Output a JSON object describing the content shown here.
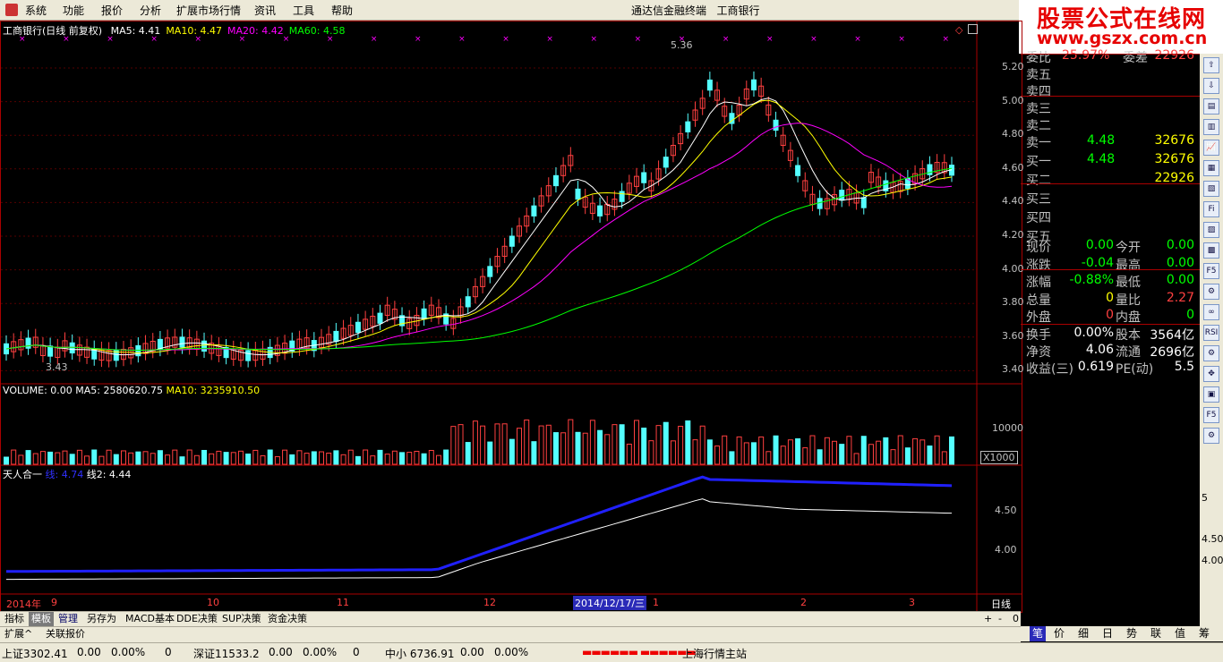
{
  "menu": {
    "items": [
      "系统",
      "功能",
      "报价",
      "分析",
      "扩展市场行情",
      "资讯",
      "工具",
      "帮助"
    ],
    "app_title": "通达信金融终端",
    "stock_title": "工商银行"
  },
  "brand": {
    "line1": "股票公式在线网",
    "line2": "www.gszx.com.cn"
  },
  "main_chart": {
    "title": "工商银行(日线 前复权)",
    "ma": [
      {
        "label": "MA5: 4.41",
        "color": "#ffffff"
      },
      {
        "label": "MA10: 4.47",
        "color": "#ffff00"
      },
      {
        "label": "MA20: 4.42",
        "color": "#ff00ff"
      },
      {
        "label": "MA60: 4.58",
        "color": "#00ff00"
      }
    ],
    "price_ticks": [
      "5.20",
      "5.00",
      "4.80",
      "4.60",
      "4.40",
      "4.20",
      "4.00",
      "3.80",
      "3.60",
      "3.40"
    ],
    "high_label": "5.36",
    "low_label": "3.43"
  },
  "volume_chart": {
    "title": "VOLUME: 0.00",
    "ma5": "MA5: 2580620.75",
    "ma10": "MA10: 3235910.50",
    "tick": "10000",
    "unit": "X1000"
  },
  "indicator_chart": {
    "title": "天人合一",
    "line1": "线: 4.74",
    "line2": "线2: 4.44",
    "ticks": [
      "4.50",
      "4.00"
    ]
  },
  "date_axis": {
    "labels": [
      "2014年",
      "9",
      "10",
      "11",
      "12",
      "1",
      "2",
      "3"
    ],
    "cursor_date": "2014/12/17/三",
    "period": "日线"
  },
  "quote": {
    "weibi_label": "委比",
    "weibi_value": "25.97%",
    "weicha_label": "委差",
    "weicha_value": "22926",
    "sell": [
      {
        "label": "卖五",
        "price": "",
        "vol": ""
      },
      {
        "label": "卖四",
        "price": "",
        "vol": ""
      },
      {
        "label": "卖三",
        "price": "",
        "vol": ""
      },
      {
        "label": "卖二",
        "price": "",
        "vol": ""
      },
      {
        "label": "卖一",
        "price": "4.48",
        "vol": "32676"
      }
    ],
    "buy": [
      {
        "label": "买一",
        "price": "4.48",
        "vol": "32676"
      },
      {
        "label": "买二",
        "price": "",
        "vol": "22926"
      },
      {
        "label": "买三",
        "price": "",
        "vol": ""
      },
      {
        "label": "买四",
        "price": "",
        "vol": ""
      },
      {
        "label": "买五",
        "price": "",
        "vol": ""
      }
    ],
    "stats": [
      {
        "l1": "现价",
        "v1": "0.00",
        "l2": "今开",
        "v2": "0.00",
        "c1": "#00ff00",
        "c2": "#00ff00"
      },
      {
        "l1": "涨跌",
        "v1": "-0.04",
        "l2": "最高",
        "v2": "0.00",
        "c1": "#00ff00",
        "c2": "#00ff00"
      },
      {
        "l1": "涨幅",
        "v1": "-0.88%",
        "l2": "最低",
        "v2": "0.00",
        "c1": "#00ff00",
        "c2": "#00ff00"
      },
      {
        "l1": "总量",
        "v1": "0",
        "l2": "量比",
        "v2": "2.27",
        "c1": "#ffff00",
        "c2": "#ff4040"
      },
      {
        "l1": "外盘",
        "v1": "0",
        "l2": "内盘",
        "v2": "0",
        "c1": "#ff4040",
        "c2": "#00ff00"
      }
    ],
    "finance": [
      {
        "l1": "换手",
        "v1": "0.00%",
        "l2": "股本",
        "v2": "3564亿"
      },
      {
        "l1": "净资",
        "v1": "4.06",
        "l2": "流通",
        "v2": "2696亿"
      },
      {
        "l1": "收益(三)",
        "v1": "0.619",
        "l2": "PE(动)",
        "v2": "5.5"
      }
    ]
  },
  "side_tools": [
    "⇧",
    "⇩",
    "▤",
    "▥",
    "📈",
    "▦",
    "▧",
    "Fi",
    "▨",
    "▩",
    "F5",
    "⚙",
    "∞",
    "RSI",
    "⚙",
    "✥",
    "▣",
    "F5",
    "⚙"
  ],
  "side_ticks": [
    "5",
    "4.50",
    "4.00"
  ],
  "tabs": [
    "指标",
    "模板",
    "管理",
    "另存为",
    "MACD基本",
    "DDE决策",
    "SUP决策",
    "资金决策"
  ],
  "tabs2": [
    "扩展^",
    "关联报价"
  ],
  "tab_controls": [
    "+",
    "-",
    "0"
  ],
  "panel_tabs": [
    "笔",
    "价",
    "细",
    "日",
    "势",
    "联",
    "值",
    "筹"
  ],
  "status": {
    "sh_label": "上证",
    "sh_value": "3302.41",
    "sh_chg": "0.00",
    "sh_pct": "0.00%",
    "sh_vol": "0",
    "sz_label": "深证",
    "sz_value": "11533.2",
    "sz_chg": "0.00",
    "sz_pct": "0.00%",
    "sz_vol": "0",
    "zx_label": "中小",
    "zx_value": "6736.91",
    "zx_chg": "0.00",
    "zx_pct": "0.00%",
    "server": "上海行情主站"
  }
}
